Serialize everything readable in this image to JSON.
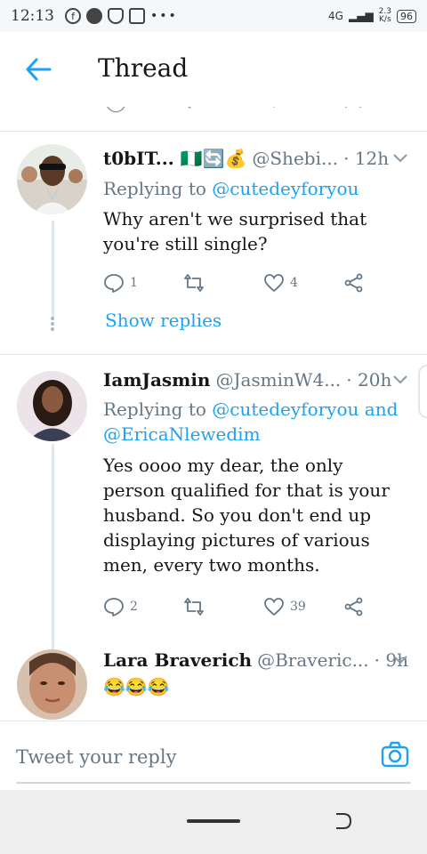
{
  "status_bar": {
    "time": "12:13",
    "network": "4G",
    "speed_value": "2.3",
    "speed_unit": "K/s",
    "battery": "96"
  },
  "header": {
    "title": "Thread"
  },
  "tweets": [
    {
      "name": "t0bIT... 🇳🇬🔄💰",
      "handle": "@Shebi...",
      "time": "· 12h",
      "replying_prefix": "Replying to",
      "replying_to": "@cutedeyforyou",
      "body": "Why aren't we surprised that you're still single?",
      "reply_count": "1",
      "retweet_count": "",
      "like_count": "4",
      "show_replies": "Show replies"
    },
    {
      "name": "IamJasmin",
      "handle": "@JasminW4...",
      "time": "· 20h",
      "replying_prefix": "Replying to",
      "replying_to": "@cutedeyforyou",
      "replying_and": "and",
      "replying_to_2": "@EricaNlewedim",
      "body": "Yes oooo my dear, the only person qualified for that is your husband. So you don't end up displaying pictures of various men, every two months.",
      "reply_count": "2",
      "retweet_count": "",
      "like_count": "39"
    },
    {
      "name": "Lara Braverich",
      "handle": "@Braveric...",
      "time": "· 9h",
      "body": "😂😂😂"
    }
  ],
  "composer": {
    "placeholder": "Tweet your reply"
  },
  "colors": {
    "accent": "#1da1f2",
    "muted": "#657786",
    "divider": "#e1e8ed"
  }
}
